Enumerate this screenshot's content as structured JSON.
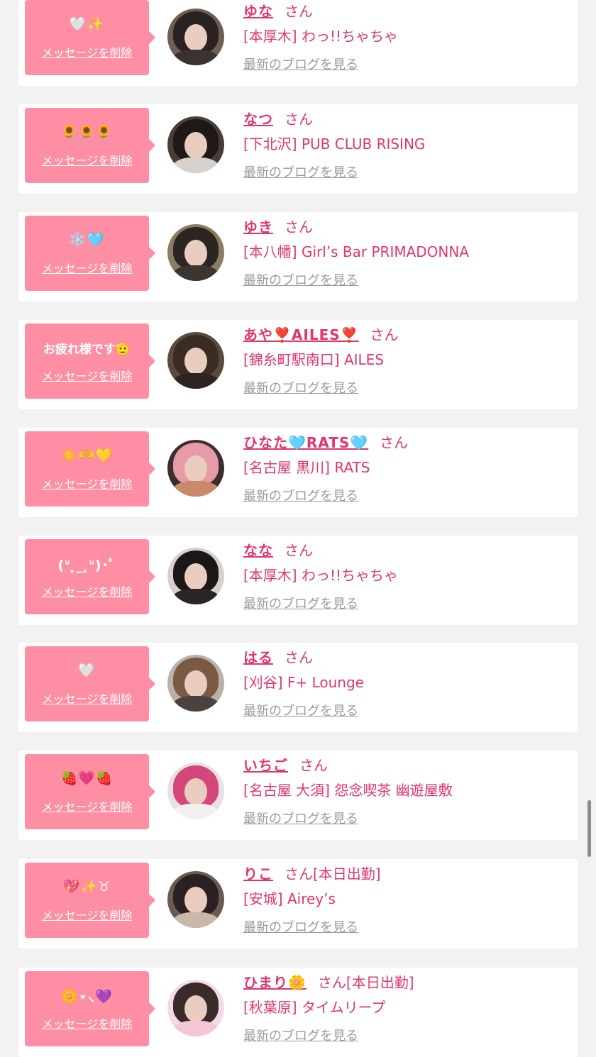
{
  "messages": [
    {
      "bubble_text": "🤍✨",
      "delete_label": "メッセージを削除",
      "name": "ゆな",
      "honorific": "さん",
      "shop": "[本厚木] わっ!!ちゃちゃ",
      "blog_link": "最新のブログを見る",
      "avatar_bg": "#6f5e55",
      "avatar_hair": "#2a2220",
      "avatar_body": "#3b3330"
    },
    {
      "bubble_text": "🌻🌻🌻",
      "delete_label": "メッセージを削除",
      "name": "なつ",
      "honorific": "さん",
      "shop": "[下北沢] PUB CLUB RISING",
      "blog_link": "最新のブログを見る",
      "avatar_bg": "#4a3c38",
      "avatar_hair": "#1e1816",
      "avatar_body": "#d9d2cc"
    },
    {
      "bubble_text": "❄️🩵",
      "delete_label": "メッセージを削除",
      "name": "ゆき",
      "honorific": "さん",
      "shop": "[本八幡] Girl’s Bar PRIMADONNA",
      "blog_link": "最新のブログを見る",
      "avatar_bg": "#8e7b63",
      "avatar_hair": "#2b2622",
      "avatar_body": "#3c3632"
    },
    {
      "bubble_text": "お疲れ様です🫡",
      "delete_label": "メッセージを削除",
      "name": "あや❣️AILES❣️",
      "honorific": "さん",
      "shop": "[錦糸町駅南口] AILES",
      "blog_link": "最新のブログを見る",
      "avatar_bg": "#5b4a3f",
      "avatar_hair": "#3a2c24",
      "avatar_body": "#2d2420"
    },
    {
      "bubble_text": "☀️🫶💛",
      "delete_label": "メッセージを削除",
      "name": "ひなた🩵RATS🩵",
      "honorific": "さん",
      "shop": "[名古屋 黒川] RATS",
      "blog_link": "最新のブログを見る",
      "avatar_bg": "#3a2e2e",
      "avatar_hair": "#e79aa8",
      "avatar_body": "#c98a6b"
    },
    {
      "bubble_text": "(ᐡ ̥_ ̥ᐡ)･ﾟ",
      "delete_label": "メッセージを削除",
      "name": "なな",
      "honorific": "さん",
      "shop": "[本厚木] わっ!!ちゃちゃ",
      "blog_link": "最新のブログを見る",
      "avatar_bg": "#d8d0cc",
      "avatar_hair": "#1b1717",
      "avatar_body": "#2a2424"
    },
    {
      "bubble_text": "🤍",
      "delete_label": "メッセージを削除",
      "name": "はる",
      "honorific": "さん",
      "shop": "[刈谷] F+ Lounge",
      "blog_link": "最新のブログを見る",
      "avatar_bg": "#b9b2aa",
      "avatar_hair": "#7a5a43",
      "avatar_body": "#4a423e"
    },
    {
      "bubble_text": "🍓💗🍓",
      "delete_label": "メッセージを削除",
      "name": "いちご",
      "honorific": "さん",
      "shop": "[名古屋 大須] 怨念喫茶 幽遊屋敷",
      "blog_link": "最新のブログを見る",
      "avatar_bg": "#e8e0e4",
      "avatar_hair": "#d4477a",
      "avatar_body": "#f2f0f0"
    },
    {
      "bubble_text": "💖✨♉",
      "delete_label": "メッセージを削除",
      "name": "りこ",
      "honorific": "さん[本日出勤]",
      "shop": "[安城] Airey’s",
      "blog_link": "最新のブログを見る",
      "avatar_bg": "#6a5a52",
      "avatar_hair": "#2a2222",
      "avatar_body": "#c8b8a8"
    },
    {
      "bubble_text": "🌼⋆⸜💜",
      "delete_label": "メッセージを削除",
      "name": "ひまり🌼",
      "honorific": "さん[本日出勤]",
      "shop": "[秋葉原] タイムリープ",
      "blog_link": "最新のブログを見る",
      "avatar_bg": "#f3dbe6",
      "avatar_hair": "#3a2a2a",
      "avatar_body": "#f5c6d6"
    }
  ]
}
